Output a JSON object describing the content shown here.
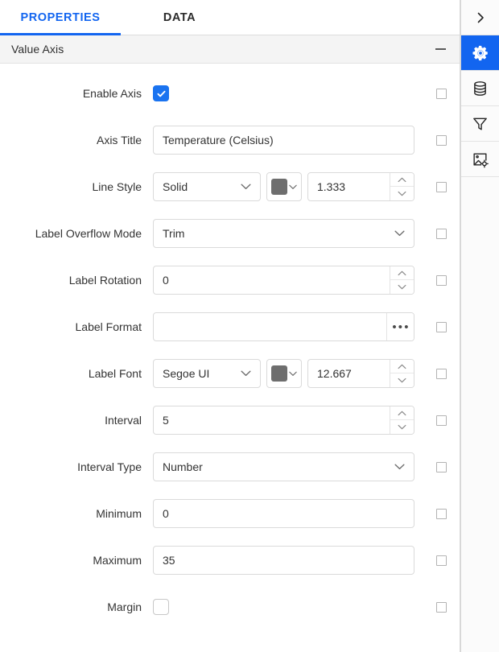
{
  "tabs": [
    {
      "label": "PROPERTIES",
      "active": true
    },
    {
      "label": "DATA",
      "active": false
    }
  ],
  "section": {
    "title": "Value Axis",
    "collapse_icon": "minus-icon"
  },
  "colors": {
    "accent": "#1265f0",
    "checkbox_on": "#1a73f0",
    "swatch_gray": "#6e6e6e",
    "border": "#dadada",
    "section_bg": "#f4f4f4"
  },
  "rail": {
    "items": [
      {
        "icon": "chevron-right-icon",
        "name": "expand-panel",
        "active": false
      },
      {
        "icon": "gear-icon",
        "name": "settings",
        "active": true
      },
      {
        "icon": "database-icon",
        "name": "data-source",
        "active": false
      },
      {
        "icon": "filter-icon",
        "name": "filter",
        "active": false
      },
      {
        "icon": "image-settings-icon",
        "name": "image-settings",
        "active": false
      }
    ]
  },
  "rows": [
    {
      "label": "Enable Axis",
      "type": "checkbox",
      "checked": true
    },
    {
      "label": "Axis Title",
      "type": "text",
      "value": "Temperature (Celsius)",
      "placeholder": ""
    },
    {
      "label": "Line Style",
      "type": "style",
      "select_value": "Solid",
      "color": "#6e6e6e",
      "number": "1.333"
    },
    {
      "label": "Label Overflow Mode",
      "type": "select",
      "value": "Trim"
    },
    {
      "label": "Label Rotation",
      "type": "number",
      "value": "0"
    },
    {
      "label": "Label Format",
      "type": "ellipsis",
      "value": "",
      "placeholder": "",
      "button_label": "•••"
    },
    {
      "label": "Label Font",
      "type": "style",
      "select_value": "Segoe UI",
      "color": "#6e6e6e",
      "number": "12.667"
    },
    {
      "label": "Interval",
      "type": "number",
      "value": "5"
    },
    {
      "label": "Interval Type",
      "type": "select",
      "value": "Number"
    },
    {
      "label": "Minimum",
      "type": "text",
      "value": "0",
      "placeholder": ""
    },
    {
      "label": "Maximum",
      "type": "text",
      "value": "35",
      "placeholder": ""
    },
    {
      "label": "Margin",
      "type": "checkbox",
      "checked": false
    }
  ]
}
